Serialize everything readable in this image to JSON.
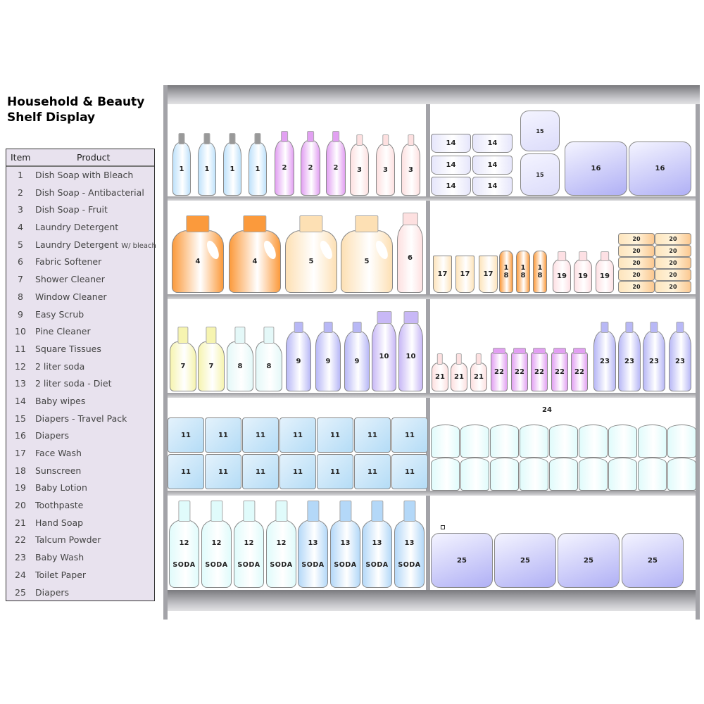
{
  "title": [
    "Household & Beauty",
    "Shelf Display"
  ],
  "legend": {
    "headers": {
      "item": "Item",
      "product": "Product"
    },
    "rows": [
      {
        "item": "1",
        "product": "Dish Soap with Bleach"
      },
      {
        "item": "2",
        "product": "Dish Soap - Antibacterial"
      },
      {
        "item": "3",
        "product": "Dish Soap - Fruit"
      },
      {
        "item": "4",
        "product": "Laundry Detergent"
      },
      {
        "item": "5",
        "product": "Laundry Detergent",
        "suffix": "W/ bleach"
      },
      {
        "item": "6",
        "product": "Fabric Softener"
      },
      {
        "item": "7",
        "product": "Shower Cleaner"
      },
      {
        "item": "8",
        "product": "Window Cleaner"
      },
      {
        "item": "9",
        "product": "Easy Scrub"
      },
      {
        "item": "10",
        "product": "Pine Cleaner"
      },
      {
        "item": "11",
        "product": "Square Tissues"
      },
      {
        "item": "12",
        "product": "2 liter soda"
      },
      {
        "item": "13",
        "product": "2 liter soda - Diet"
      },
      {
        "item": "14",
        "product": "Baby wipes"
      },
      {
        "item": "15",
        "product": "Diapers - Travel Pack"
      },
      {
        "item": "16",
        "product": "Diapers"
      },
      {
        "item": "17",
        "product": "Face Wash"
      },
      {
        "item": "18",
        "product": "Sunscreen"
      },
      {
        "item": "19",
        "product": "Baby Lotion"
      },
      {
        "item": "20",
        "product": "Toothpaste"
      },
      {
        "item": "21",
        "product": "Hand Soap"
      },
      {
        "item": "22",
        "product": "Talcum Powder"
      },
      {
        "item": "23",
        "product": "Baby Wash"
      },
      {
        "item": "24",
        "product": "Toilet Paper"
      },
      {
        "item": "25",
        "product": "Diapers"
      }
    ]
  },
  "soda_text": "SODA",
  "toilet_paper_label": "24",
  "groups": [
    {
      "label": "1",
      "type": "bottle",
      "color": "#bfe2fb",
      "count": 4
    },
    {
      "label": "2",
      "type": "bottle",
      "color": "#e2a0f2",
      "count": 3
    },
    {
      "label": "3",
      "type": "bottle",
      "color": "#fde0e0",
      "count": 3
    },
    {
      "label": "14",
      "type": "wipes",
      "color": "#e6e6fb",
      "count": 6
    },
    {
      "label": "15",
      "type": "box",
      "color": "#dcdcfa",
      "count": 2
    },
    {
      "label": "16",
      "type": "box",
      "color": "#b0b0f5",
      "count": 2
    },
    {
      "label": "4",
      "type": "jug",
      "color": "#fb9a3c",
      "count": 2
    },
    {
      "label": "5",
      "type": "jug",
      "color": "#fde0b4",
      "count": 2
    },
    {
      "label": "6",
      "type": "tall",
      "color": "#fde0e0",
      "count": 1
    },
    {
      "label": "17",
      "type": "tube",
      "color": "#fde4bc",
      "count": 3
    },
    {
      "label": "18",
      "type": "tube",
      "color": "#fb9a3c",
      "count": 3
    },
    {
      "label": "19",
      "type": "lotion",
      "color": "#fde0e4",
      "count": 3
    },
    {
      "label": "20",
      "type": "paste",
      "color": "#fde4bc",
      "count": 10
    },
    {
      "label": "7",
      "type": "spray",
      "color": "#f6f4b0",
      "count": 2
    },
    {
      "label": "8",
      "type": "spray",
      "color": "#e4f8f8",
      "count": 2
    },
    {
      "label": "9",
      "type": "bottle",
      "color": "#b8b8f6",
      "count": 3
    },
    {
      "label": "10",
      "type": "tall",
      "color": "#c8b8f6",
      "count": 2
    },
    {
      "label": "21",
      "type": "pump",
      "color": "#fde0e0",
      "count": 3
    },
    {
      "label": "22",
      "type": "canister",
      "color": "#e2a0f2",
      "count": 5
    },
    {
      "label": "23",
      "type": "bottle",
      "color": "#b8b8f6",
      "count": 4
    },
    {
      "label": "11",
      "type": "tissue",
      "color": "#b4dcf6",
      "count": 14
    },
    {
      "label": "",
      "type": "roll",
      "color": "#e0fbfb",
      "count": 18
    },
    {
      "label": "12",
      "type": "soda",
      "color": "#e0fbfb",
      "count": 4
    },
    {
      "label": "13",
      "type": "soda",
      "color": "#b4d8f8",
      "count": 4
    },
    {
      "label": "25",
      "type": "box",
      "color": "#b0b0f5",
      "count": 4
    }
  ]
}
